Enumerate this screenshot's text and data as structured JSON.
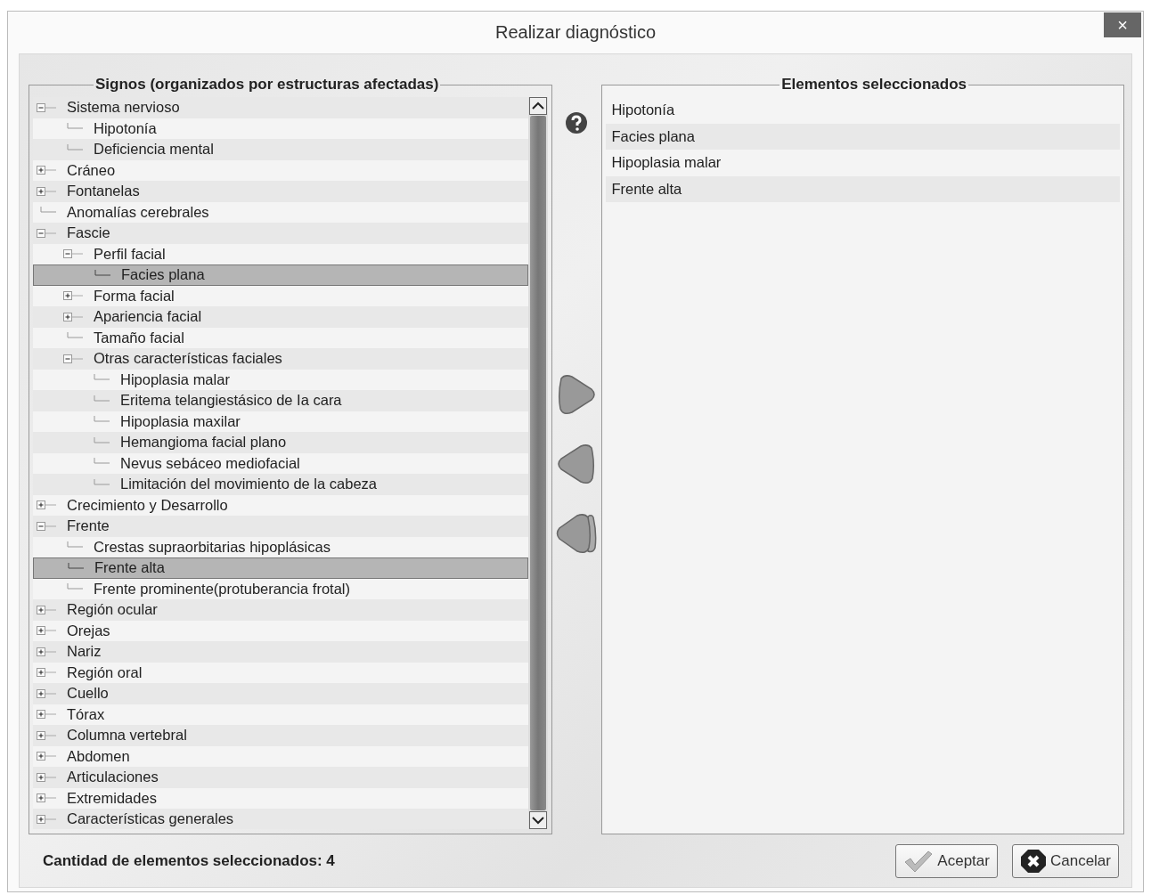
{
  "window": {
    "title": "Realizar diagnóstico",
    "close": "×"
  },
  "signs": {
    "title": "Signos (organizados por estructuras afectadas)",
    "tree": [
      {
        "label": "Sistema nervioso",
        "expanded": true,
        "selected": false,
        "children": [
          {
            "label": "Hipotonía",
            "selected": false
          },
          {
            "label": "Deficiencia mental",
            "selected": false
          }
        ]
      },
      {
        "label": "Cráneo",
        "expanded": false,
        "selected": false
      },
      {
        "label": "Fontanelas",
        "expanded": false,
        "selected": false
      },
      {
        "label": "Anomalías cerebrales",
        "selected": false
      },
      {
        "label": "Fascie",
        "expanded": true,
        "selected": false,
        "children": [
          {
            "label": "Perfil facial",
            "expanded": true,
            "selected": false,
            "children": [
              {
                "label": "Facies plana",
                "selected": true
              }
            ]
          },
          {
            "label": "Forma facial",
            "expanded": false,
            "selected": false
          },
          {
            "label": "Apariencia facial",
            "expanded": false,
            "selected": false
          },
          {
            "label": "Tamaño facial",
            "selected": false
          },
          {
            "label": "Otras características faciales",
            "expanded": true,
            "selected": false,
            "children": [
              {
                "label": "Hipoplasia malar",
                "selected": false
              },
              {
                "label": "Eritema telangiestásico de Ia cara",
                "selected": false
              },
              {
                "label": "Hipoplasia maxilar",
                "selected": false
              },
              {
                "label": "Hemangioma facial plano",
                "selected": false
              },
              {
                "label": "Nevus sebáceo mediofacial",
                "selected": false
              },
              {
                "label": "Limitación del movimiento de la cabeza",
                "selected": false
              }
            ]
          }
        ]
      },
      {
        "label": "Crecimiento y Desarrollo",
        "expanded": false,
        "selected": false
      },
      {
        "label": "Frente",
        "expanded": true,
        "selected": false,
        "children": [
          {
            "label": "Crestas supraorbitarias hipoplásicas",
            "selected": false
          },
          {
            "label": "Frente alta",
            "selected": true
          },
          {
            "label": "Frente prominente(protuberancia frotal)",
            "selected": false
          }
        ]
      },
      {
        "label": "Región ocular",
        "expanded": false,
        "selected": false
      },
      {
        "label": "Orejas",
        "expanded": false,
        "selected": false
      },
      {
        "label": "Nariz",
        "expanded": false,
        "selected": false
      },
      {
        "label": "Región oral",
        "expanded": false,
        "selected": false
      },
      {
        "label": "Cuello",
        "expanded": false,
        "selected": false
      },
      {
        "label": "Tórax",
        "expanded": false,
        "selected": false
      },
      {
        "label": "Columna vertebral",
        "expanded": false,
        "selected": false
      },
      {
        "label": "Abdomen",
        "expanded": false,
        "selected": false
      },
      {
        "label": "Articulaciones",
        "expanded": false,
        "selected": false
      },
      {
        "label": "Extremidades",
        "expanded": false,
        "selected": false
      },
      {
        "label": "Características generales",
        "expanded": false,
        "selected": false
      }
    ]
  },
  "selected_items": {
    "title": "Elementos seleccionados",
    "items": [
      "Hipotonía",
      "Facies plana",
      "Hipoplasia malar",
      "Frente alta"
    ]
  },
  "footer": {
    "count_label": "Cantidad de elementos seleccionados: 4",
    "buttons": [
      {
        "label": "Aceptar",
        "kind": "accept"
      },
      {
        "label": "Cancelar",
        "kind": "cancel"
      }
    ]
  }
}
